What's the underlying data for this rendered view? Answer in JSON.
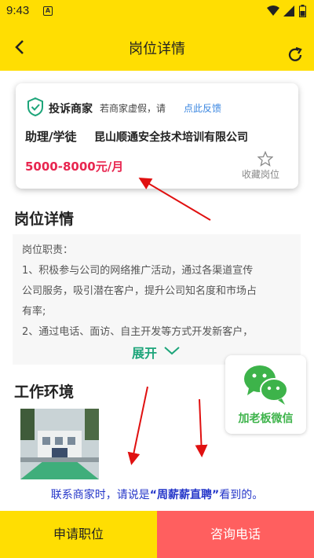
{
  "status_bar": {
    "time": "9:43",
    "notification_icon": "A"
  },
  "header": {
    "title": "岗位详情",
    "back_icon": "back-arrow-icon",
    "refresh_icon": "refresh-icon"
  },
  "card": {
    "complain_title": "投诉商家",
    "complain_sub": "若商家虚假，请",
    "complain_link": "点此反馈",
    "job_title": "助理/学徒",
    "company": "昆山顺通安全技术培训有限公司",
    "salary": "5000-8000元/月",
    "favorite_label": "收藏岗位"
  },
  "details": {
    "section_title": "岗位详情",
    "lines": [
      "岗位职责：",
      "1、积极参与公司的网络推广活动，通过各渠道宣传",
      "公司服务，吸引潜在客户，提升公司知名度和市场占",
      "有率;",
      "2、通过电话、面访、自主开发等方式开发新客户，"
    ],
    "expand_label": "展开"
  },
  "environment": {
    "section_title": "工作环境"
  },
  "wechat": {
    "label": "加老板微信"
  },
  "notice": {
    "prefix": "联系商家时，请说是",
    "highlight": "“周薪薪直聘”",
    "suffix": "看到的。"
  },
  "buttons": {
    "apply": "申请职位",
    "call": "咨询电话"
  },
  "colors": {
    "accent_yellow": "#ffde02",
    "salary_red": "#e8254f",
    "call_red": "#ff5f5f",
    "link_blue": "#3a86e0",
    "wechat_green": "#3db34a"
  }
}
